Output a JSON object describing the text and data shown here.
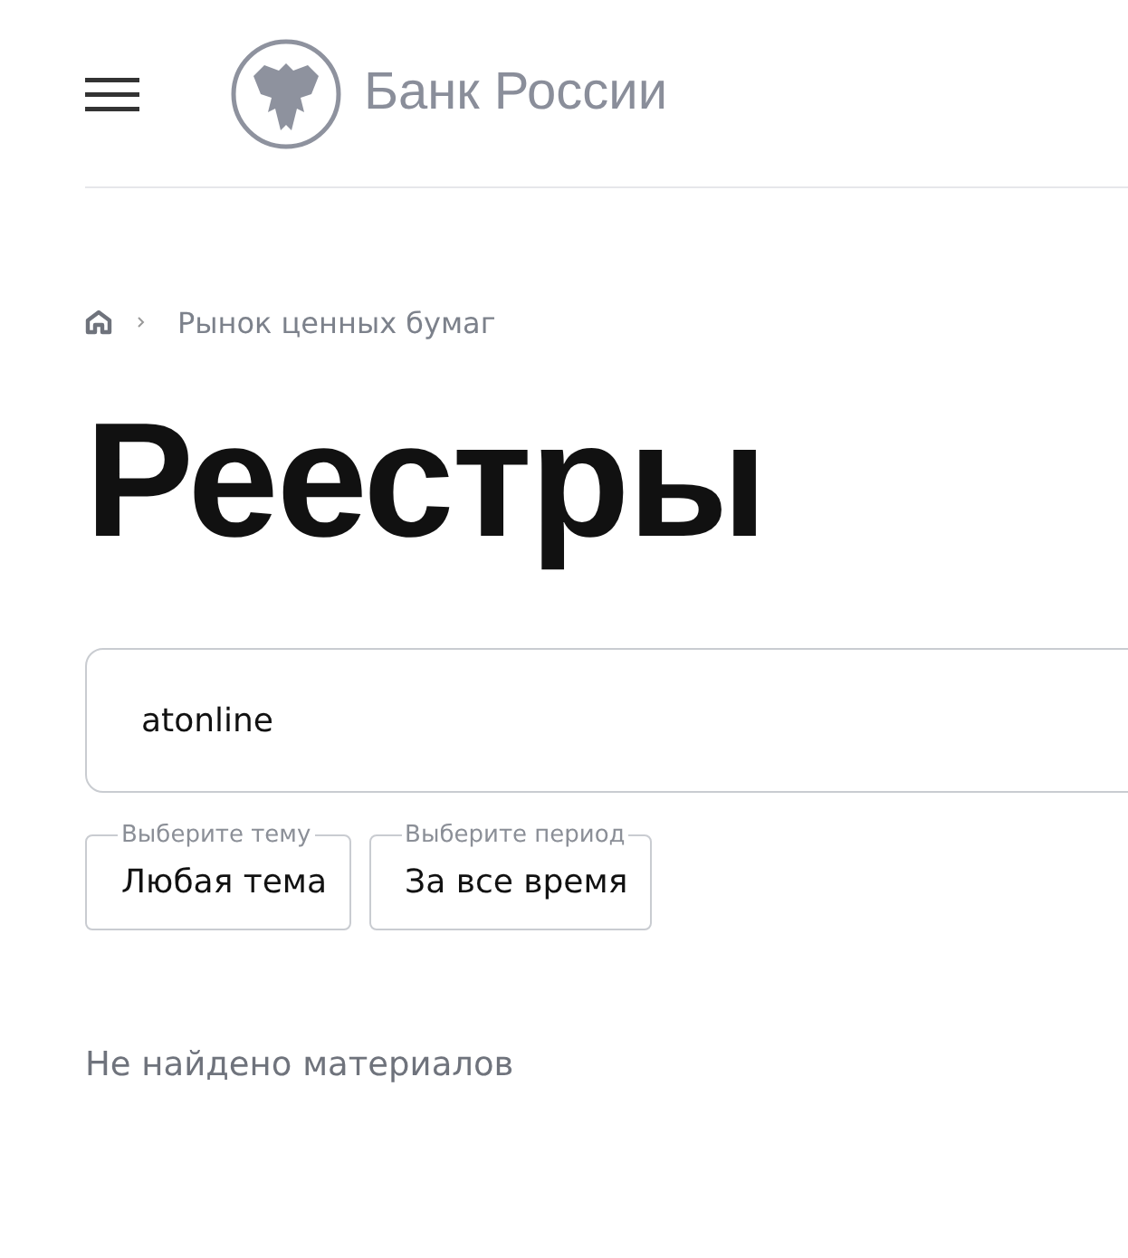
{
  "header": {
    "logo_text": "Банк России"
  },
  "breadcrumb": [
    "Рынок ценных бумаг"
  ],
  "title": "Реестры",
  "search": {
    "value": "atonline"
  },
  "filters": [
    {
      "label": "Выберите тему",
      "value": "Любая тема"
    },
    {
      "label": "Выберите период",
      "value": "За все время"
    }
  ],
  "message": "Не найдено материалов"
}
